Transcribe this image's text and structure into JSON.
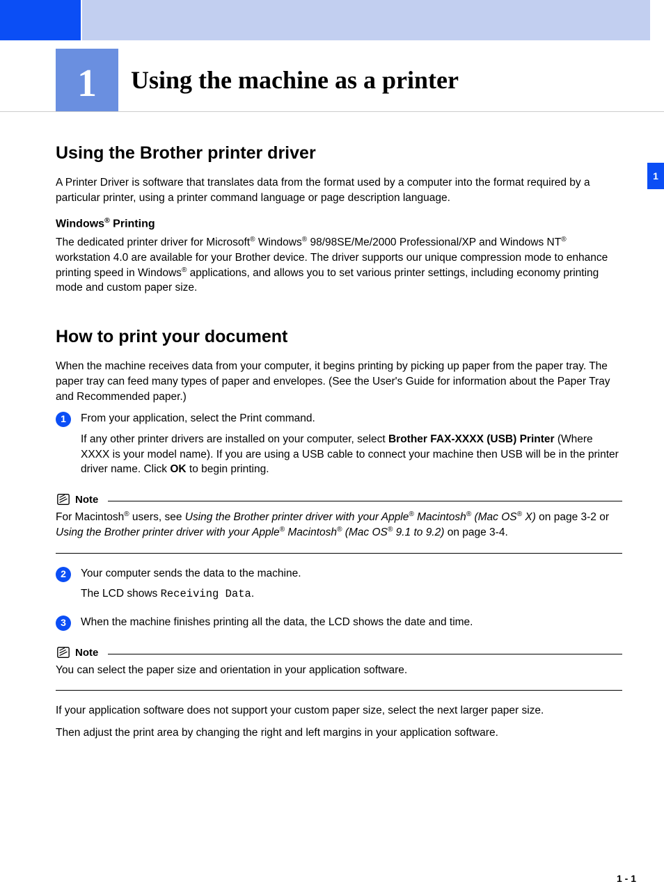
{
  "chapter": {
    "number": "1",
    "title": "Using the machine as a printer"
  },
  "sideTab": "1",
  "section1": {
    "heading": "Using the Brother printer driver",
    "intro": "A Printer Driver is software that translates data from the format used by a computer into the format required by a particular printer, using a printer command language or page description language.",
    "sub_a": "Windows",
    "sub_b": " Printing",
    "win1": "The dedicated printer driver for Microsoft",
    "win2": " Windows",
    "win3": " 98/98SE/Me/2000 Professional/XP and Windows NT",
    "win4": " workstation 4.0 are available for your Brother device. The driver supports our unique compression mode to enhance printing speed in Windows",
    "win5": " applications, and allows you to set various printer settings, including economy printing mode and custom paper size."
  },
  "section2": {
    "heading": "How to print your document",
    "intro": "When the machine receives data from your computer, it begins printing by picking up paper from the paper tray. The paper tray can feed many types of paper and envelopes. (See the User's Guide for information about the Paper Tray and Recommended paper.)",
    "step1_a": "From your application, select the Print command.",
    "step1_b1": "If any other printer drivers are installed on your computer, select ",
    "step1_b_bold": "Brother FAX-XXXX (USB) Printer",
    "step1_b2": " (Where XXXX is your model name). If you are using a USB cable to connect your machine then USB will be in the printer driver name. Click ",
    "step1_b_bold2": "OK",
    "step1_b3": " to begin printing.",
    "note1_label": "Note",
    "note1_a": "For Macintosh",
    "note1_b": " users, see ",
    "note1_it1": "Using the Brother printer driver with your Apple",
    "note1_it2": " Macintosh",
    "note1_it3": " (Mac OS",
    "note1_it4": " X)",
    "note1_c": " on page 3-2 or ",
    "note1_it5": "Using the Brother printer driver with your Apple",
    "note1_it6": " Macintosh",
    "note1_it7": " (Mac OS",
    "note1_it8": " 9.1 to 9.2)",
    "note1_d": " on page 3-4.",
    "step2_a": "Your computer sends the data to the machine.",
    "step2_b1": "The LCD shows ",
    "step2_b_mono": "Receiving Data",
    "step2_b2": ".",
    "step3": "When the machine finishes printing all the data, the LCD shows the date and time.",
    "note2_label": "Note",
    "note2_body": "You can select the paper size and orientation in your application software.",
    "tail1": "If your application software does not support your custom paper size, select the next larger paper size.",
    "tail2": "Then adjust the print area by changing the right and left margins in your application software."
  },
  "footer": "1 - 1",
  "reg": "®"
}
